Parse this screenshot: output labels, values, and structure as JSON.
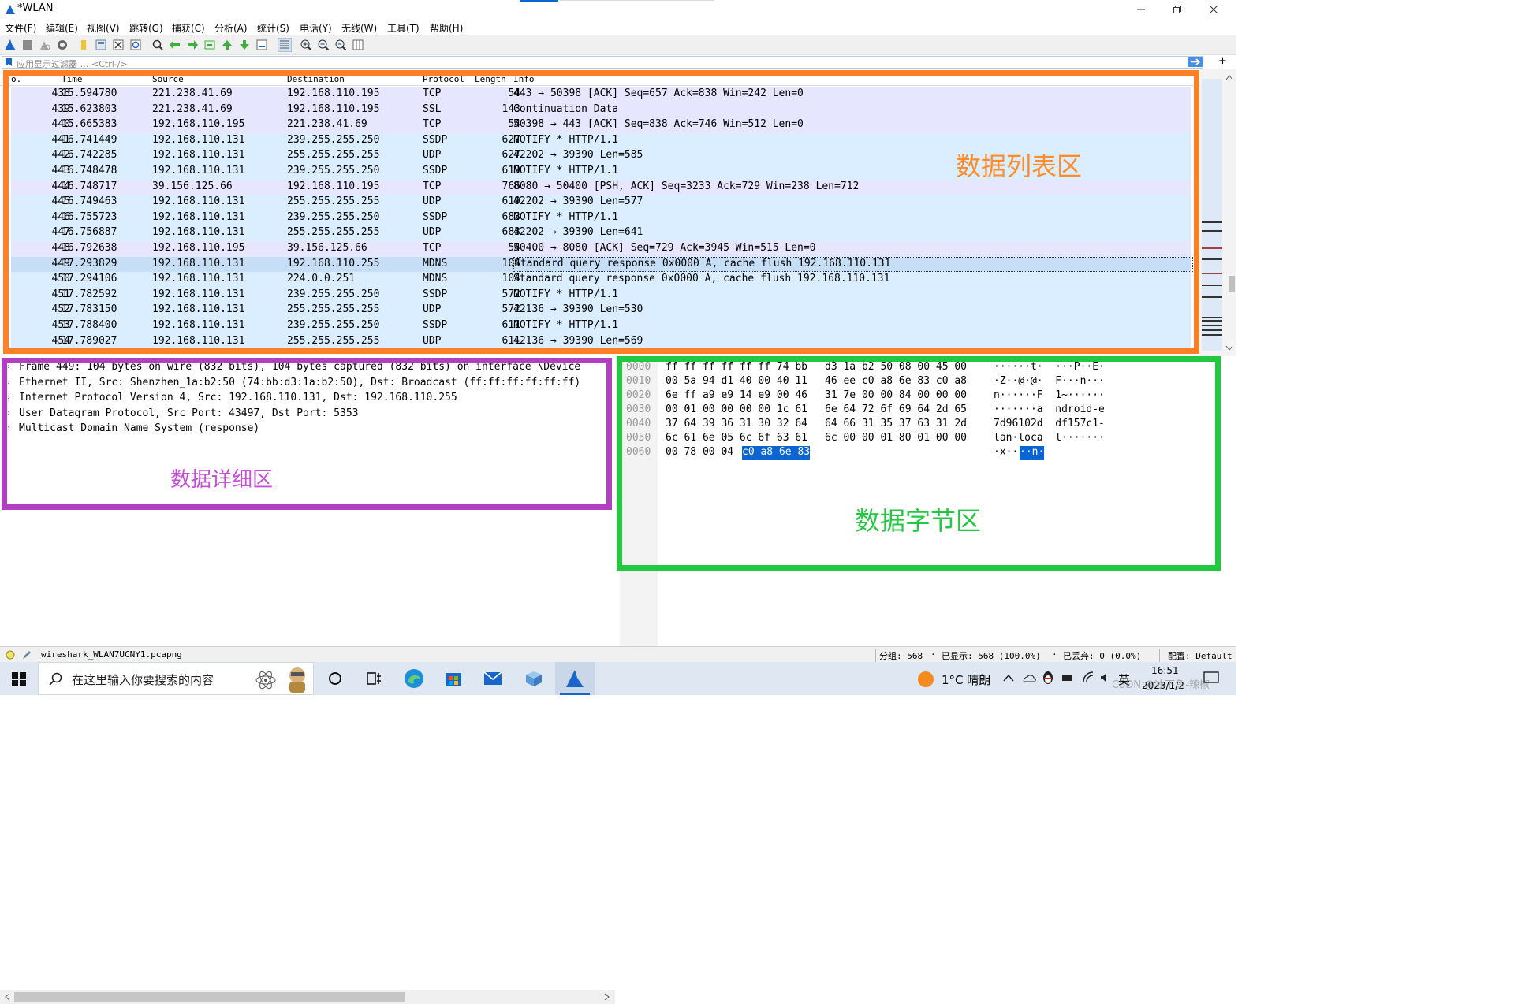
{
  "window": {
    "title": "*WLAN"
  },
  "menu": [
    "文件(F)",
    "编辑(E)",
    "视图(V)",
    "跳转(G)",
    "捕获(C)",
    "分析(A)",
    "统计(S)",
    "电话(Y)",
    "无线(W)",
    "工具(T)",
    "帮助(H)"
  ],
  "filter": {
    "placeholder": "应用显示过滤器 … <Ctrl-/>"
  },
  "columns": [
    "o.",
    "Time",
    "Source",
    "Destination",
    "Protocol",
    "Length",
    "Info"
  ],
  "packets": [
    {
      "no": "438",
      "time": "15.594780",
      "src": "221.238.41.69",
      "dst": "192.168.110.195",
      "proto": "TCP",
      "len": "54",
      "info": "443 → 50398 [ACK] Seq=657 Ack=838 Win=242 Len=0"
    },
    {
      "no": "439",
      "time": "15.623803",
      "src": "221.238.41.69",
      "dst": "192.168.110.195",
      "proto": "SSL",
      "len": "143",
      "info": "Continuation Data"
    },
    {
      "no": "440",
      "time": "15.665383",
      "src": "192.168.110.195",
      "dst": "221.238.41.69",
      "proto": "TCP",
      "len": "54",
      "info": "50398 → 443 [ACK] Seq=838 Ack=746 Win=512 Len=0"
    },
    {
      "no": "441",
      "time": "16.741449",
      "src": "192.168.110.131",
      "dst": "239.255.255.250",
      "proto": "SSDP",
      "len": "627",
      "info": "NOTIFY * HTTP/1.1"
    },
    {
      "no": "442",
      "time": "16.742285",
      "src": "192.168.110.131",
      "dst": "255.255.255.255",
      "proto": "UDP",
      "len": "627",
      "info": "42202 → 39390 Len=585"
    },
    {
      "no": "443",
      "time": "16.748478",
      "src": "192.168.110.131",
      "dst": "239.255.255.250",
      "proto": "SSDP",
      "len": "619",
      "info": "NOTIFY * HTTP/1.1"
    },
    {
      "no": "444",
      "time": "16.748717",
      "src": "39.156.125.66",
      "dst": "192.168.110.195",
      "proto": "TCP",
      "len": "766",
      "info": "8080 → 50400 [PSH, ACK] Seq=3233 Ack=729 Win=238 Len=712"
    },
    {
      "no": "445",
      "time": "16.749463",
      "src": "192.168.110.131",
      "dst": "255.255.255.255",
      "proto": "UDP",
      "len": "619",
      "info": "42202 → 39390 Len=577"
    },
    {
      "no": "446",
      "time": "16.755723",
      "src": "192.168.110.131",
      "dst": "239.255.255.250",
      "proto": "SSDP",
      "len": "683",
      "info": "NOTIFY * HTTP/1.1"
    },
    {
      "no": "447",
      "time": "16.756887",
      "src": "192.168.110.131",
      "dst": "255.255.255.255",
      "proto": "UDP",
      "len": "683",
      "info": "42202 → 39390 Len=641"
    },
    {
      "no": "448",
      "time": "16.792638",
      "src": "192.168.110.195",
      "dst": "39.156.125.66",
      "proto": "TCP",
      "len": "54",
      "info": "50400 → 8080 [ACK] Seq=729 Ack=3945 Win=515 Len=0"
    },
    {
      "no": "449",
      "time": "17.293829",
      "src": "192.168.110.131",
      "dst": "192.168.110.255",
      "proto": "MDNS",
      "len": "104",
      "info": "Standard query response 0x0000 A, cache flush 192.168.110.131"
    },
    {
      "no": "450",
      "time": "17.294106",
      "src": "192.168.110.131",
      "dst": "224.0.0.251",
      "proto": "MDNS",
      "len": "104",
      "info": "Standard query response 0x0000 A, cache flush 192.168.110.131"
    },
    {
      "no": "451",
      "time": "17.782592",
      "src": "192.168.110.131",
      "dst": "239.255.255.250",
      "proto": "SSDP",
      "len": "572",
      "info": "NOTIFY * HTTP/1.1"
    },
    {
      "no": "452",
      "time": "17.783150",
      "src": "192.168.110.131",
      "dst": "255.255.255.255",
      "proto": "UDP",
      "len": "572",
      "info": "42136 → 39390 Len=530"
    },
    {
      "no": "453",
      "time": "17.788400",
      "src": "192.168.110.131",
      "dst": "239.255.255.250",
      "proto": "SSDP",
      "len": "611",
      "info": "NOTIFY * HTTP/1.1"
    },
    {
      "no": "454",
      "time": "17.789027",
      "src": "192.168.110.131",
      "dst": "255.255.255.255",
      "proto": "UDP",
      "len": "611",
      "info": "42136 → 39390 Len=569"
    }
  ],
  "selected_packet": "449",
  "details": [
    "Frame 449: 104 bytes on wire (832 bits), 104 bytes captured (832 bits) on interface \\Device",
    "Ethernet II, Src: Shenzhen_1a:b2:50 (74:bb:d3:1a:b2:50), Dst: Broadcast (ff:ff:ff:ff:ff:ff)",
    "Internet Protocol Version 4, Src: 192.168.110.131, Dst: 192.168.110.255",
    "User Datagram Protocol, Src Port: 43497, Dst Port: 5353",
    "Multicast Domain Name System (response)"
  ],
  "bytes": [
    {
      "off": "0000",
      "hex1": "ff ff ff ff ff ff 74 bb",
      "hex2": "d3 1a b2 50 08 00 45 00",
      "ascii": "······t·  ···P··E·"
    },
    {
      "off": "0010",
      "hex1": "00 5a 94 d1 40 00 40 11",
      "hex2": "46 ee c0 a8 6e 83 c0 a8",
      "ascii": "·Z··@·@·  F···n···"
    },
    {
      "off": "0020",
      "hex1": "6e ff a9 e9 14 e9 00 46",
      "hex2": "31 7e 00 00 84 00 00 00",
      "ascii": "n······F  1~······"
    },
    {
      "off": "0030",
      "hex1": "00 01 00 00 00 00 1c 61",
      "hex2": "6e 64 72 6f 69 64 2d 65",
      "ascii": "·······a  ndroid-e"
    },
    {
      "off": "0040",
      "hex1": "37 64 39 36 31 30 32 64",
      "hex2": "64 66 31 35 37 63 31 2d",
      "ascii": "7d96102d  df157c1-"
    },
    {
      "off": "0050",
      "hex1": "6c 61 6e 05 6c 6f 63 61",
      "hex2": "6c 00 00 01 80 01 00 00",
      "ascii": "lan·loca  l·······"
    },
    {
      "off": "0060",
      "hex1": "00 78 00 04",
      "hex_sel": "c0 a8 6e 83",
      "ascii": "·x··",
      "ascii_sel": "··n·"
    }
  ],
  "annotations": {
    "list": "数据列表区",
    "detail": "数据详细区",
    "bytes": "数据字节区"
  },
  "status": {
    "file": "wireshark_WLAN7UCNY1.pcapng",
    "groups": "分组: 568",
    "shown": "已显示: 568 (100.0%)",
    "dropped": "已丢弃: 0 (0.0%)",
    "profile": "配置: Default"
  },
  "taskbar": {
    "search_placeholder": "在这里输入你要搜索的内容",
    "weather": "1°C 晴朗",
    "ime": "英",
    "time": "16:51",
    "date": "2023/1/2",
    "watermark": "CSDN @冰下鱼-辣椒"
  },
  "colors": {
    "tcp_row": "#e7e6ff",
    "udp_row": "#daeeff",
    "selected_row": "#c6dff7",
    "list_box": "#ff7f27",
    "detail_box": "#b23fc1",
    "bytes_box": "#22c940"
  }
}
